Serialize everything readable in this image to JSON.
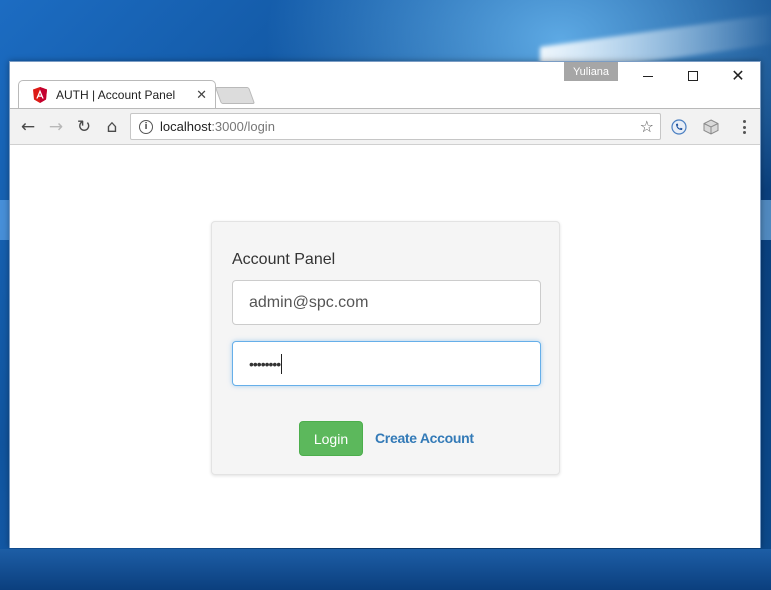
{
  "window": {
    "profile_name": "Yuliana",
    "controls": {
      "minimize": "minimize",
      "maximize": "maximize",
      "close": "close"
    }
  },
  "tab": {
    "title": "AUTH | Account Panel",
    "close_glyph": "✕",
    "icon": "angular-icon"
  },
  "toolbar": {
    "back_glyph": "←",
    "forward_glyph": "→",
    "reload_glyph": "↻",
    "home_glyph": "⌂",
    "url_host": "localhost",
    "url_path": ":3000/login",
    "star_glyph": "☆",
    "info_glyph": "i"
  },
  "login": {
    "title": "Account Panel",
    "email_value": "admin@spc.com",
    "password_mask": "••••••••",
    "login_label": "Login",
    "create_account_label": "Create Account"
  },
  "colors": {
    "login_button": "#5cb85c",
    "link": "#337ab7",
    "focus_border": "#66afe9",
    "angular_red": "#dd1b16"
  }
}
